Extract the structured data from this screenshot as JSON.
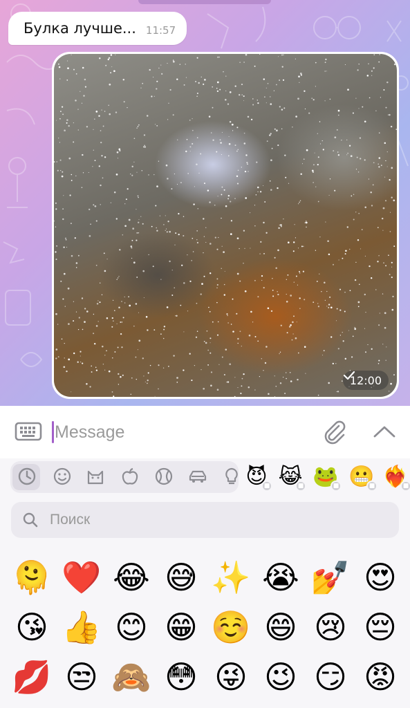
{
  "chat": {
    "messages": [
      {
        "text": "Булка лучше...",
        "time": "11:57"
      }
    ],
    "media": {
      "time": "12:00",
      "status_icon": "check-icon"
    },
    "colors": {
      "accent": "#a25fc9",
      "wallpaper_start": "#e7a6d8",
      "wallpaper_end": "#a9b6ef"
    }
  },
  "composer": {
    "placeholder": "Message",
    "value": "",
    "icons": [
      "keyboard-icon",
      "paperclip-icon",
      "chevron-up-icon"
    ]
  },
  "emoji_panel": {
    "categories": [
      "recent-icon",
      "smiley-icon",
      "cat-icon",
      "apple-icon",
      "ball-icon",
      "car-icon",
      "lightbulb-icon"
    ],
    "packs": [
      "😈",
      "😹",
      "🐸",
      "😬",
      "❤️‍🔥"
    ],
    "search_placeholder": "Поиск",
    "emojis": [
      [
        "🫠",
        "❤️",
        "😂",
        "😅",
        "✨",
        "😭",
        "💅",
        "😍"
      ],
      [
        "😘",
        "👍",
        "😊",
        "😁",
        "☺️",
        "😄",
        "😢",
        "😔"
      ],
      [
        "💋",
        "😒",
        "🙈",
        "😳",
        "😜",
        "😉",
        "😏",
        "😡"
      ]
    ]
  }
}
